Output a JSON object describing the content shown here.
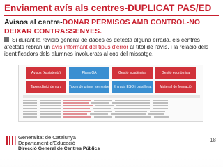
{
  "slide": {
    "title": "Enviament avís als centres-DUPLICAT PAS/ED",
    "subtitle_dark": "Avisos al centre-",
    "subtitle_red": "DONAR PERMISOS AMB CONTROL-NO DEIXAR CONTRASSENYES.",
    "bullet_part1": "Si durant la revisió general de dades es detecta alguna errada, els centres afectats rebran un ",
    "bullet_red": "avís informant del tipus d'error",
    "bullet_part2": " al títol de l'avís, i la relació dels identificadors dels alumnes involucrats al cos del missatge.",
    "page_number": "18"
  },
  "tiles": [
    {
      "label": "Avisos (Assistents)",
      "color": "#d1323a"
    },
    {
      "label": "Plans QA",
      "color": "#3a8fd1"
    },
    {
      "label": "Gestió acadèmica",
      "color": "#d1323a"
    },
    {
      "label": "Gestió econòmica",
      "color": "#d1323a"
    },
    {
      "label": "Taxes d'inici de curs",
      "color": "#d1323a"
    },
    {
      "label": "Taxes de primer semestre",
      "color": "#3a8fd1"
    },
    {
      "label": "Entrada ESO i batxillerat",
      "color": "#3a8fd1"
    },
    {
      "label": "Material de formació",
      "color": "#d1323a"
    }
  ],
  "footer": {
    "line1": "Generalitat de Catalunya",
    "line2": "Departament d'Educació",
    "line3": "Direcció General de Centres Públics"
  }
}
